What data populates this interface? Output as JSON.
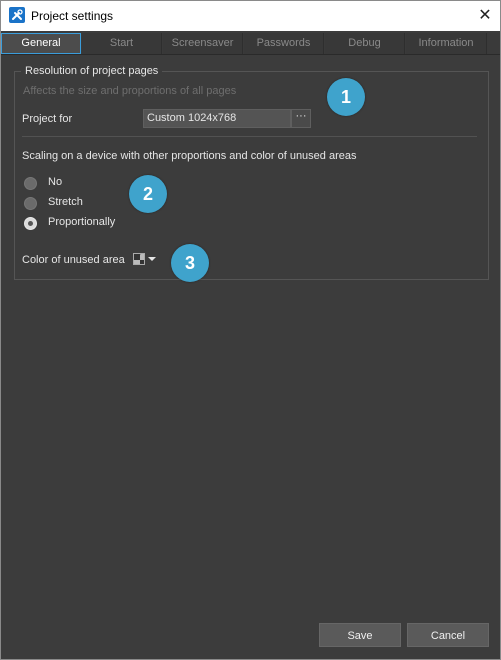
{
  "window": {
    "title": "Project settings",
    "close_glyph": "✕"
  },
  "tabs": [
    {
      "label": "General",
      "active": true
    },
    {
      "label": "Start"
    },
    {
      "label": "Screensaver"
    },
    {
      "label": "Passwords"
    },
    {
      "label": "Debug"
    },
    {
      "label": "Information"
    }
  ],
  "resolution": {
    "group_title": "Resolution of project pages",
    "hint": "Affects the size and proportions of all pages",
    "project_for_label": "Project for",
    "project_for_value": "Custom 1024x768",
    "browse_glyph": "···"
  },
  "scaling": {
    "heading": "Scaling on a device with other proportions and color of unused areas",
    "options": [
      {
        "label": "No",
        "checked": false
      },
      {
        "label": "Stretch",
        "checked": false
      },
      {
        "label": "Proportionally",
        "checked": true
      }
    ]
  },
  "unused_color": {
    "label": "Color of unused area"
  },
  "badges": [
    "1",
    "2",
    "3"
  ],
  "buttons": {
    "save": "Save",
    "cancel": "Cancel"
  },
  "colors": {
    "background": "#3c3c3c",
    "accent": "#3b9ddb",
    "badge": "#3fa3cc"
  },
  "icons": {
    "app": "tools-icon",
    "close": "close-icon",
    "color_swatch": "checkerboard-swatch-icon",
    "dropdown": "caret-down-icon"
  }
}
